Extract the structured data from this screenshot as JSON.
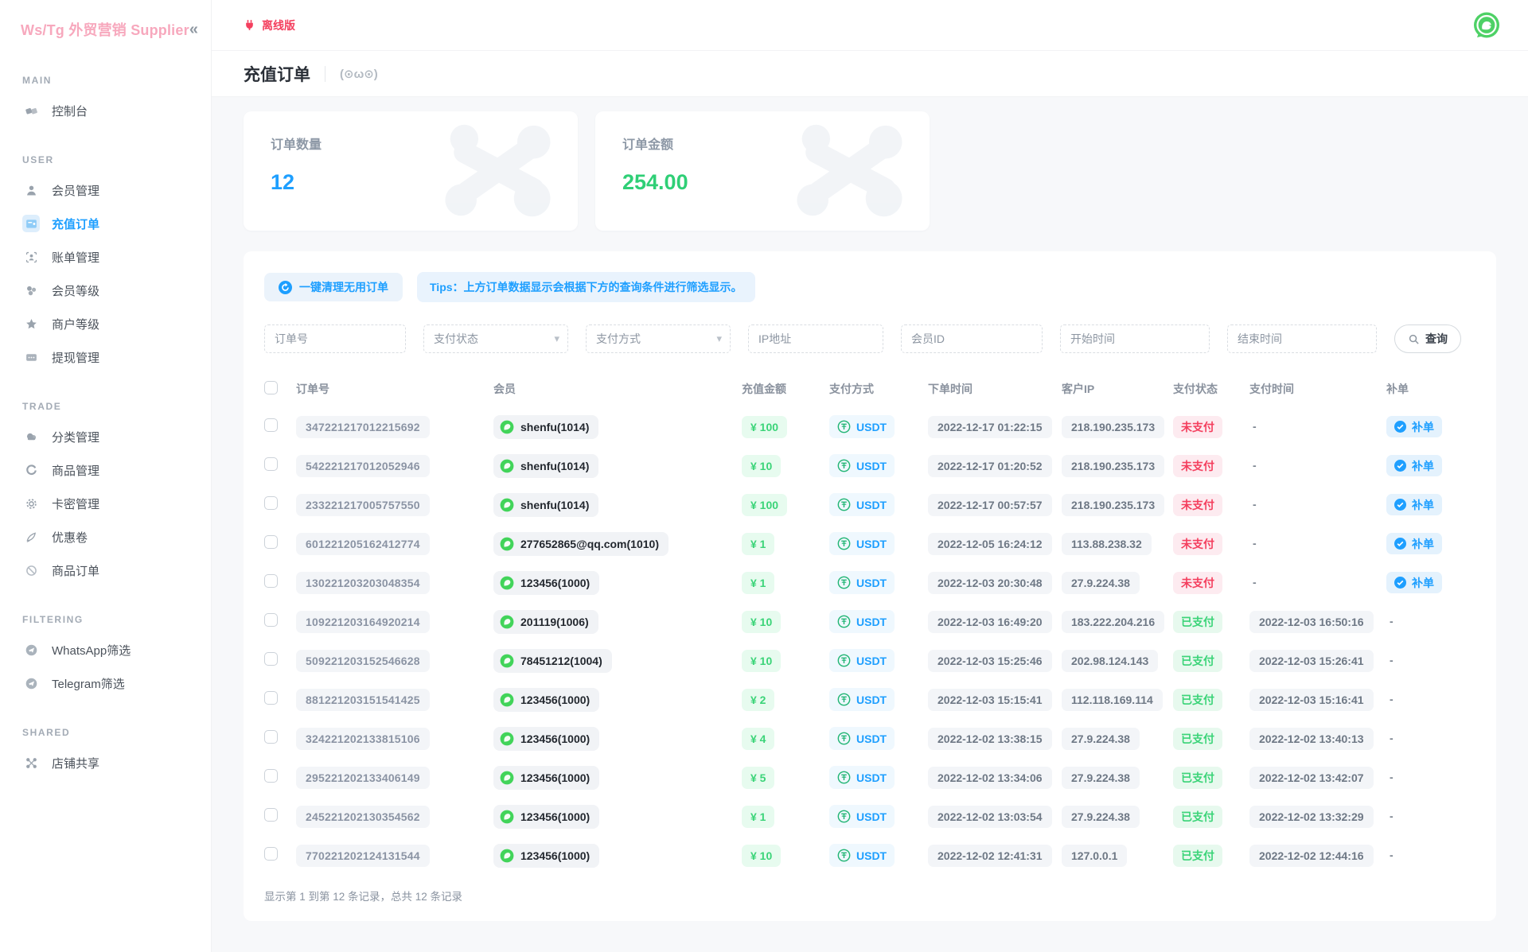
{
  "brand": {
    "name": "Ws/Tg 外贸营销 Supplier",
    "collapse": "«"
  },
  "topbar": {
    "offline": "离线版"
  },
  "page": {
    "title": "充值订单",
    "emoticon": "(⊙ω⊙)"
  },
  "colors": {
    "accent": "#1e9fff",
    "success": "#3bd478",
    "danger": "#f43f5e",
    "brand_pink": "#f7a8bd"
  },
  "sidebar": {
    "sections": [
      {
        "title": "MAIN",
        "items": [
          {
            "label": "控制台",
            "icon": "dashboard-icon"
          }
        ]
      },
      {
        "title": "USER",
        "items": [
          {
            "label": "会员管理",
            "icon": "member-icon"
          },
          {
            "label": "充值订单",
            "icon": "recharge-order-icon",
            "active": true
          },
          {
            "label": "账单管理",
            "icon": "bill-icon"
          },
          {
            "label": "会员等级",
            "icon": "member-level-icon"
          },
          {
            "label": "商户等级",
            "icon": "merchant-level-icon"
          },
          {
            "label": "提现管理",
            "icon": "withdraw-icon"
          }
        ]
      },
      {
        "title": "TRADE",
        "items": [
          {
            "label": "分类管理",
            "icon": "category-icon"
          },
          {
            "label": "商品管理",
            "icon": "product-icon"
          },
          {
            "label": "卡密管理",
            "icon": "card-key-icon"
          },
          {
            "label": "优惠卷",
            "icon": "coupon-icon"
          },
          {
            "label": "商品订单",
            "icon": "product-order-icon"
          }
        ]
      },
      {
        "title": "FILTERING",
        "items": [
          {
            "label": "WhatsApp筛选",
            "icon": "whatsapp-filter-icon"
          },
          {
            "label": "Telegram筛选",
            "icon": "telegram-filter-icon"
          }
        ]
      },
      {
        "title": "SHARED",
        "items": [
          {
            "label": "店铺共享",
            "icon": "shop-share-icon"
          }
        ]
      }
    ]
  },
  "stats": {
    "cards": [
      {
        "label": "订单数量",
        "value": "12",
        "color": "#1e9fff"
      },
      {
        "label": "订单金额",
        "value": "254.00",
        "color": "#2fcf76"
      }
    ]
  },
  "actions": {
    "clean": "一键清理无用订单",
    "tips": "Tips：上方订单数据显示会根据下方的查询条件进行筛选显示。"
  },
  "filters": {
    "fields": [
      {
        "name": "order-no",
        "placeholder": "订单号",
        "type": "text"
      },
      {
        "name": "pay-status",
        "placeholder": "支付状态",
        "type": "select"
      },
      {
        "name": "pay-method",
        "placeholder": "支付方式",
        "type": "select"
      },
      {
        "name": "ip",
        "placeholder": "IP地址",
        "type": "text"
      },
      {
        "name": "member-id",
        "placeholder": "会员ID",
        "type": "text"
      },
      {
        "name": "start-time",
        "placeholder": "开始时间",
        "type": "text"
      },
      {
        "name": "end-time",
        "placeholder": "结束时间",
        "type": "text"
      }
    ],
    "search": "查询"
  },
  "table": {
    "headers": [
      "订单号",
      "会员",
      "充值金额",
      "支付方式",
      "下单时间",
      "客户IP",
      "支付状态",
      "支付时间",
      "补单"
    ],
    "rows": [
      {
        "order": "347221217012215692",
        "member": "shenfu(1014)",
        "amount": "¥ 100",
        "method": "USDT",
        "order_time": "2022-12-17 01:22:15",
        "ip": "218.190.235.173",
        "status": "未支付",
        "status_type": "unpaid",
        "pay_time": "-",
        "reissue": "补单"
      },
      {
        "order": "542221217012052946",
        "member": "shenfu(1014)",
        "amount": "¥ 10",
        "method": "USDT",
        "order_time": "2022-12-17 01:20:52",
        "ip": "218.190.235.173",
        "status": "未支付",
        "status_type": "unpaid",
        "pay_time": "-",
        "reissue": "补单"
      },
      {
        "order": "233221217005757550",
        "member": "shenfu(1014)",
        "amount": "¥ 100",
        "method": "USDT",
        "order_time": "2022-12-17 00:57:57",
        "ip": "218.190.235.173",
        "status": "未支付",
        "status_type": "unpaid",
        "pay_time": "-",
        "reissue": "补单"
      },
      {
        "order": "601221205162412774",
        "member": "277652865@qq.com(1010)",
        "amount": "¥ 1",
        "method": "USDT",
        "order_time": "2022-12-05 16:24:12",
        "ip": "113.88.238.32",
        "status": "未支付",
        "status_type": "unpaid",
        "pay_time": "-",
        "reissue": "补单"
      },
      {
        "order": "130221203203048354",
        "member": "123456(1000)",
        "amount": "¥ 1",
        "method": "USDT",
        "order_time": "2022-12-03 20:30:48",
        "ip": "27.9.224.38",
        "status": "未支付",
        "status_type": "unpaid",
        "pay_time": "-",
        "reissue": "补单"
      },
      {
        "order": "109221203164920214",
        "member": "201119(1006)",
        "amount": "¥ 10",
        "method": "USDT",
        "order_time": "2022-12-03 16:49:20",
        "ip": "183.222.204.216",
        "status": "已支付",
        "status_type": "paid",
        "pay_time": "2022-12-03 16:50:16",
        "reissue": "-"
      },
      {
        "order": "509221203152546628",
        "member": "78451212(1004)",
        "amount": "¥ 10",
        "method": "USDT",
        "order_time": "2022-12-03 15:25:46",
        "ip": "202.98.124.143",
        "status": "已支付",
        "status_type": "paid",
        "pay_time": "2022-12-03 15:26:41",
        "reissue": "-"
      },
      {
        "order": "881221203151541425",
        "member": "123456(1000)",
        "amount": "¥ 2",
        "method": "USDT",
        "order_time": "2022-12-03 15:15:41",
        "ip": "112.118.169.114",
        "status": "已支付",
        "status_type": "paid",
        "pay_time": "2022-12-03 15:16:41",
        "reissue": "-"
      },
      {
        "order": "324221202133815106",
        "member": "123456(1000)",
        "amount": "¥ 4",
        "method": "USDT",
        "order_time": "2022-12-02 13:38:15",
        "ip": "27.9.224.38",
        "status": "已支付",
        "status_type": "paid",
        "pay_time": "2022-12-02 13:40:13",
        "reissue": "-"
      },
      {
        "order": "295221202133406149",
        "member": "123456(1000)",
        "amount": "¥ 5",
        "method": "USDT",
        "order_time": "2022-12-02 13:34:06",
        "ip": "27.9.224.38",
        "status": "已支付",
        "status_type": "paid",
        "pay_time": "2022-12-02 13:42:07",
        "reissue": "-"
      },
      {
        "order": "245221202130354562",
        "member": "123456(1000)",
        "amount": "¥ 1",
        "method": "USDT",
        "order_time": "2022-12-02 13:03:54",
        "ip": "27.9.224.38",
        "status": "已支付",
        "status_type": "paid",
        "pay_time": "2022-12-02 13:32:29",
        "reissue": "-"
      },
      {
        "order": "770221202124131544",
        "member": "123456(1000)",
        "amount": "¥ 10",
        "method": "USDT",
        "order_time": "2022-12-02 12:41:31",
        "ip": "127.0.0.1",
        "status": "已支付",
        "status_type": "paid",
        "pay_time": "2022-12-02 12:44:16",
        "reissue": "-"
      }
    ]
  },
  "pagination": {
    "summary": "显示第 1 到第 12 条记录，总共 12 条记录"
  }
}
